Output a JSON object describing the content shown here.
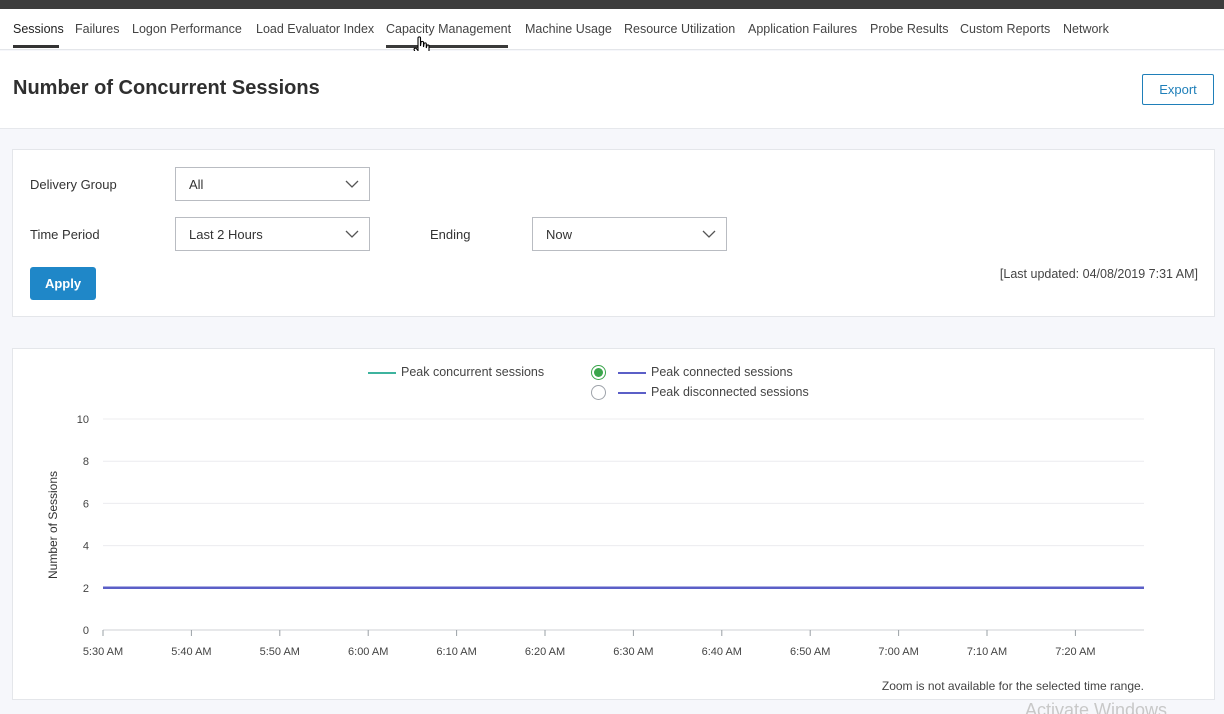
{
  "nav": {
    "tabs": [
      {
        "label": "Sessions",
        "active": true
      },
      {
        "label": "Failures"
      },
      {
        "label": "Logon Performance"
      },
      {
        "label": "Load Evaluator Index"
      },
      {
        "label": "Capacity Management",
        "hover": true
      },
      {
        "label": "Machine Usage"
      },
      {
        "label": "Resource Utilization"
      },
      {
        "label": "Application Failures"
      },
      {
        "label": "Probe Results"
      },
      {
        "label": "Custom Reports"
      },
      {
        "label": "Network"
      }
    ]
  },
  "header": {
    "title": "Number of Concurrent Sessions",
    "export_label": "Export"
  },
  "filters": {
    "delivery_group_label": "Delivery Group",
    "delivery_group_value": "All",
    "time_period_label": "Time Period",
    "time_period_value": "Last 2 Hours",
    "ending_label": "Ending",
    "ending_value": "Now",
    "apply_label": "Apply",
    "last_updated": "[Last updated: 04/08/2019 7:31 AM]"
  },
  "colors": {
    "accent": "#1f87c8",
    "concurrent": "#3db39e",
    "connected": "#5b5fc7",
    "disconnected": "#5b5fc7",
    "radio_selected": "#3aa54b"
  },
  "chart_data": {
    "type": "line",
    "ylabel": "Number of Sessions",
    "xlabel": "",
    "ylim": [
      0,
      10
    ],
    "yticks": [
      0,
      2,
      4,
      6,
      8,
      10
    ],
    "x": [
      "5:30 AM",
      "5:40 AM",
      "5:50 AM",
      "6:00 AM",
      "6:10 AM",
      "6:20 AM",
      "6:30 AM",
      "6:40 AM",
      "6:50 AM",
      "7:00 AM",
      "7:10 AM",
      "7:20 AM",
      "7:30 AM"
    ],
    "xticks": [
      "5:30 AM",
      "5:40 AM",
      "5:50 AM",
      "6:00 AM",
      "6:10 AM",
      "6:20 AM",
      "6:30 AM",
      "6:40 AM",
      "6:50 AM",
      "7:00 AM",
      "7:10 AM",
      "7:20 AM"
    ],
    "series": [
      {
        "name": "Peak concurrent sessions",
        "values": [
          2,
          2,
          2,
          2,
          2,
          2,
          2,
          2,
          2,
          2,
          2,
          2,
          2
        ]
      },
      {
        "name": "Peak connected sessions",
        "values": [
          2,
          2,
          2,
          2,
          2,
          2,
          2,
          2,
          2,
          2,
          2,
          2,
          2
        ],
        "selected": true
      },
      {
        "name": "Peak disconnected sessions",
        "values": [],
        "selected": false
      }
    ],
    "grid": true,
    "legend": "top-center",
    "zoom_note": "Zoom is not available for the selected time range."
  },
  "watermark": "Activate Windows"
}
